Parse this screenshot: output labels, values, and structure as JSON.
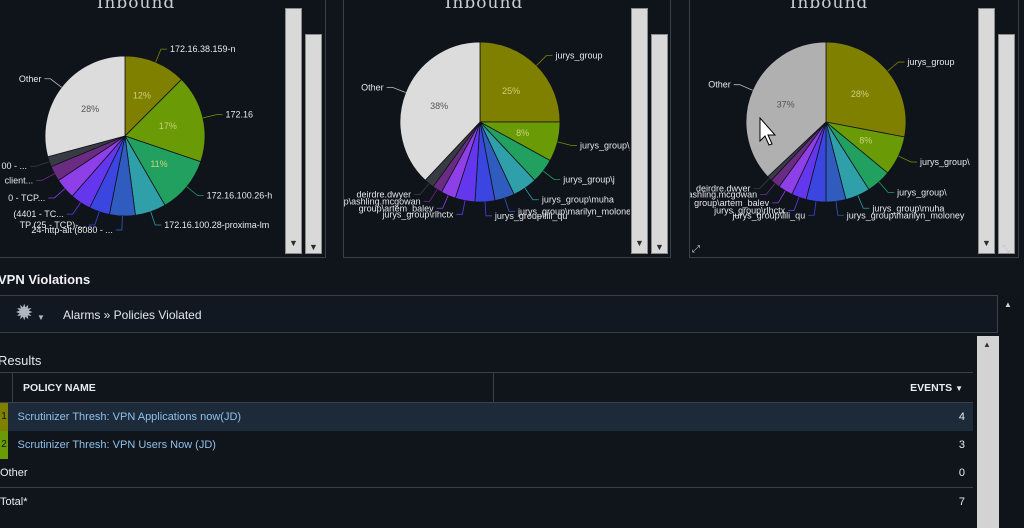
{
  "panels": [
    {
      "title": "Inbound",
      "slices": [
        {
          "pct": 12,
          "color": "#7f8000",
          "label": "172.16.38.159-n"
        },
        {
          "pct": 17,
          "color": "#6a9a06",
          "label": "172.16"
        },
        {
          "pct": 11,
          "color": "#21a060",
          "label": "172.16.100.26-h"
        },
        {
          "pct": 6,
          "color": "#2fa0aa",
          "label": "172.16.100.28-proxima-lm"
        },
        {
          "pct": 5,
          "color": "#305bbf",
          "label": "24-http-alt (8080 - ..."
        },
        {
          "pct": 4,
          "color": "#3b45e0",
          "label": "TP (25 - TCP)-..."
        },
        {
          "pct": 4,
          "color": "#6437ee",
          "label": "(4401 - TC..."
        },
        {
          "pct": 4,
          "color": "#8f3fe8",
          "label": "0 - TCP..."
        },
        {
          "pct": 3,
          "color": "#6a2c82",
          "label": "client..."
        },
        {
          "pct": 2,
          "color": "#3a3a44",
          "label": "00 - ..."
        },
        {
          "pct": 28,
          "color": "#dcdcdc",
          "label": "Other"
        }
      ],
      "pct_labels": [
        "12%",
        "17%",
        "11%",
        "28%"
      ]
    },
    {
      "title": "Inbound",
      "slices": [
        {
          "pct": 25,
          "color": "#7f8000",
          "label": "jurys_group"
        },
        {
          "pct": 8,
          "color": "#6a9a06",
          "label": "jurys_group\\j"
        },
        {
          "pct": 5,
          "color": "#21a060",
          "label": "jurys_group\\j"
        },
        {
          "pct": 5,
          "color": "#2fa0aa",
          "label": "jurys_group\\muha"
        },
        {
          "pct": 4,
          "color": "#305bbf",
          "label": "jurys_group\\marilyn_moloney"
        },
        {
          "pct": 4,
          "color": "#3b45e0",
          "label": "jurys_group\\lili_qu"
        },
        {
          "pct": 4,
          "color": "#6437ee",
          "label": "jurys_group\\rlhctx"
        },
        {
          "pct": 3,
          "color": "#8f3fe8",
          "label": "group\\artem_balev"
        },
        {
          "pct": 2,
          "color": "#6a2c82",
          "label": "p\\ashling.mcgowan"
        },
        {
          "pct": 2,
          "color": "#3a3a44",
          "label": "deirdre.dwyer"
        },
        {
          "pct": 38,
          "color": "#dcdcdc",
          "label": "Other"
        }
      ],
      "pct_labels": [
        "25%",
        "8%",
        "38%"
      ]
    },
    {
      "title": "Inbound",
      "slices": [
        {
          "pct": 28,
          "color": "#7f8000",
          "label": "jurys_group"
        },
        {
          "pct": 8,
          "color": "#6a9a06",
          "label": "jurys_group\\"
        },
        {
          "pct": 5,
          "color": "#21a060",
          "label": "jurys_group\\"
        },
        {
          "pct": 5,
          "color": "#2fa0aa",
          "label": "jurys_group\\muha"
        },
        {
          "pct": 4,
          "color": "#305bbf",
          "label": "jurys_group\\marilyn_moloney"
        },
        {
          "pct": 4,
          "color": "#3b45e0",
          "label": "jurys_group\\lili_qu"
        },
        {
          "pct": 3,
          "color": "#6437ee",
          "label": "jurys_group\\rlhctx"
        },
        {
          "pct": 3,
          "color": "#8f3fe8",
          "label": "group\\artem_balev"
        },
        {
          "pct": 2,
          "color": "#6a2c82",
          "label": "p\\ashling.mcgowan"
        },
        {
          "pct": 1,
          "color": "#3a3a44",
          "label": "deirdre.dwyer"
        },
        {
          "pct": 37,
          "color": "#b0b0b0",
          "label": "Other"
        }
      ],
      "pct_labels": [
        "28%",
        "8%",
        "37%"
      ]
    }
  ],
  "section": {
    "title": "VPN Violations"
  },
  "toolbar": {
    "breadcrumb": "Alarms » Policies Violated",
    "gear_icon": "gear-icon"
  },
  "results": {
    "label": "Results",
    "columns": {
      "policy": "POLICY NAME",
      "events": "EVENTS"
    },
    "rows": [
      {
        "idx": "1",
        "color": "#7f8000",
        "name": "Scrutinizer Thresh: VPN Applications now(JD)",
        "events": "4"
      },
      {
        "idx": "2",
        "color": "#6a9a06",
        "name": "Scrutinizer Thresh: VPN Users Now (JD)",
        "events": "3"
      }
    ],
    "other": {
      "name": "Other",
      "events": "0"
    },
    "total": {
      "name": "Total*",
      "events": "7"
    }
  }
}
